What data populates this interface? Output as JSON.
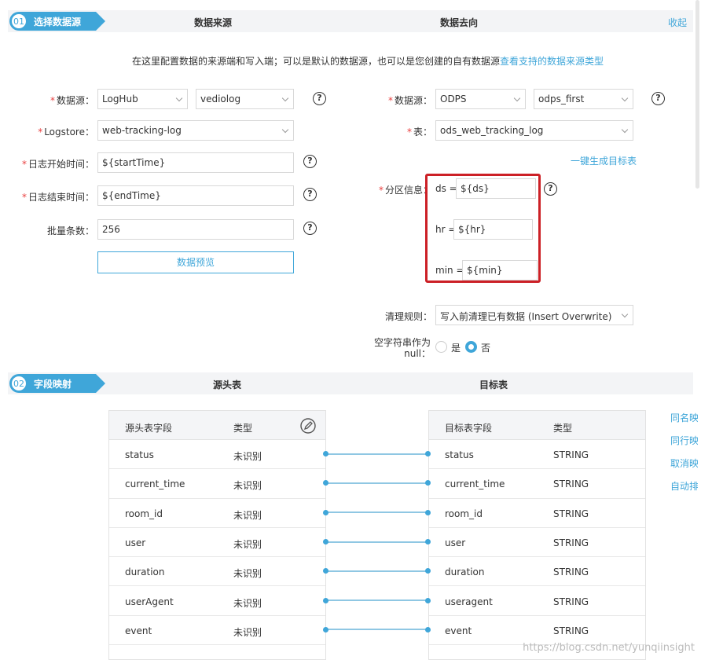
{
  "step1": {
    "num": "01",
    "label": "选择数据源",
    "col_source": "数据来源",
    "col_target": "数据去向",
    "collapse": "收起",
    "intro_text": "在这里配置数据的来源端和写入端；可以是默认的数据源，也可以是您创建的自有数据源",
    "intro_link": "查看支持的数据来源类型"
  },
  "source": {
    "datasource_label": "数据源：",
    "datasource_type": "LogHub",
    "datasource_name": "vediolog",
    "logstore_label": "Logstore：",
    "logstore_value": "web-tracking-log",
    "start_label": "日志开始时间：",
    "start_value": "${startTime}",
    "end_label": "日志结束时间：",
    "end_value": "${endTime}",
    "batch_label": "批量条数：",
    "batch_value": "256",
    "preview_button": "数据预览"
  },
  "target": {
    "datasource_label": "数据源：",
    "datasource_type": "ODPS",
    "datasource_name": "odps_first",
    "table_label": "表：",
    "table_value": "ods_web_tracking_log",
    "gen_link": "一键生成目标表",
    "partition_label": "分区信息：",
    "partitions": [
      {
        "key": "ds =",
        "value": "${ds}"
      },
      {
        "key": "hr =",
        "value": "${hr}"
      },
      {
        "key": "min =",
        "value": "${min}"
      }
    ],
    "clean_label": "清理规则：",
    "clean_value": "写入前清理已有数据 (Insert Overwrite)",
    "null_label_1": "空字符串作为",
    "null_label_2": "null：",
    "yes": "是",
    "no": "否"
  },
  "step2": {
    "num": "02",
    "label": "字段映射",
    "col_source": "源头表",
    "col_target": "目标表"
  },
  "mapping": {
    "src_headers": [
      "源头表字段",
      "类型"
    ],
    "dst_headers": [
      "目标表字段",
      "类型"
    ],
    "rows": [
      {
        "src": "status",
        "src_type": "未识别",
        "dst": "status",
        "dst_type": "STRING"
      },
      {
        "src": "current_time",
        "src_type": "未识别",
        "dst": "current_time",
        "dst_type": "STRING"
      },
      {
        "src": "room_id",
        "src_type": "未识别",
        "dst": "room_id",
        "dst_type": "STRING"
      },
      {
        "src": "user",
        "src_type": "未识别",
        "dst": "user",
        "dst_type": "STRING"
      },
      {
        "src": "duration",
        "src_type": "未识别",
        "dst": "duration",
        "dst_type": "STRING"
      },
      {
        "src": "userAgent",
        "src_type": "未识别",
        "dst": "useragent",
        "dst_type": "STRING"
      },
      {
        "src": "event",
        "src_type": "未识别",
        "dst": "event",
        "dst_type": "STRING"
      }
    ],
    "side_links": [
      "同名映射",
      "同行映射",
      "取消映射",
      "自动排版"
    ]
  },
  "watermark": "https://blog.csdn.net/yunqiinsight"
}
